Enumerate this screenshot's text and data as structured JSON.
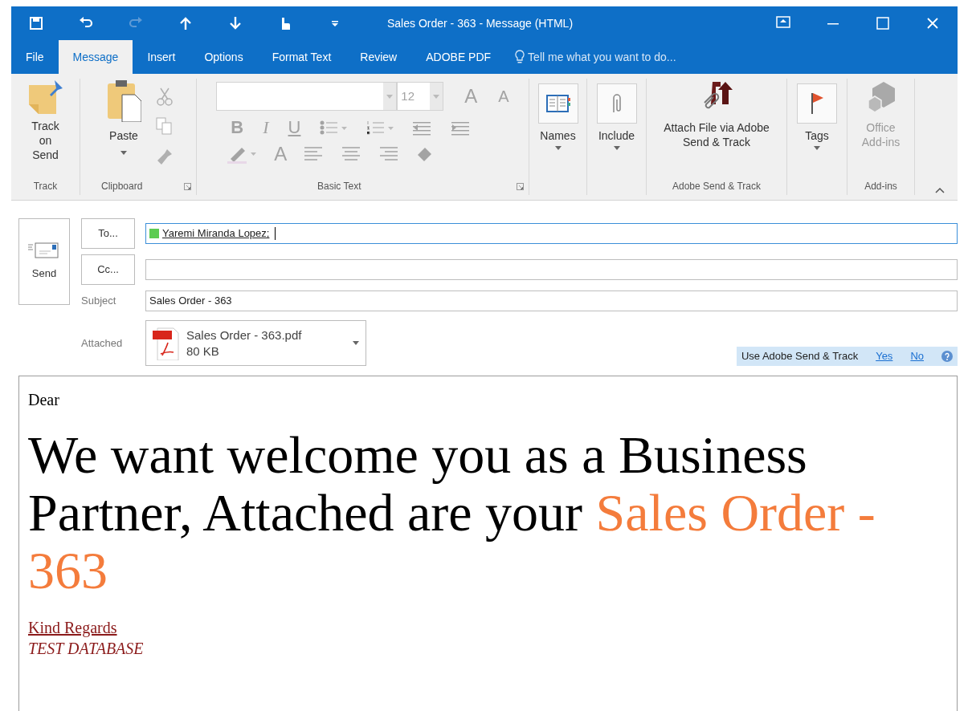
{
  "window": {
    "title": "Sales Order - 363 - Message (HTML)"
  },
  "tabs": [
    {
      "label": "File",
      "selected": false
    },
    {
      "label": "Message",
      "selected": true
    },
    {
      "label": "Insert",
      "selected": false
    },
    {
      "label": "Options",
      "selected": false
    },
    {
      "label": "Format Text",
      "selected": false
    },
    {
      "label": "Review",
      "selected": false
    },
    {
      "label": "ADOBE PDF",
      "selected": false
    }
  ],
  "tell_me": "Tell me what you want to do...",
  "ribbon": {
    "groups": [
      {
        "kind": "track",
        "label": "Track",
        "button": "Track on Send"
      },
      {
        "kind": "clipboard",
        "label": "Clipboard",
        "button": "Paste",
        "tools_disabled": true
      },
      {
        "kind": "basic_text",
        "label": "Basic Text",
        "disabled": true,
        "font_size": "12",
        "glyphs": {
          "grow": "A",
          "shrink": "A",
          "bold": "B",
          "italic": "I",
          "underline": "U",
          "font_color": "A"
        }
      },
      {
        "kind": "names",
        "button": "Names",
        "dropdown": true
      },
      {
        "kind": "include",
        "button": "Include",
        "dropdown": true
      },
      {
        "kind": "adobe",
        "label": "Adobe Send & Track",
        "button": "Attach File via Adobe Send & Track"
      },
      {
        "kind": "tags",
        "button": "Tags",
        "dropdown": true
      },
      {
        "kind": "addins",
        "label": "Add-ins",
        "button": "Office Add-ins",
        "disabled": true
      }
    ]
  },
  "compose": {
    "send_button": "Send",
    "to_button": "To...",
    "cc_button": "Cc...",
    "to": {
      "focused": true,
      "recipients": [
        {
          "name": "Yaremi Miranda Lopez;",
          "color": "#5ccc52"
        }
      ]
    },
    "subject_label": "Subject",
    "subject": "Sales Order - 363",
    "attached_label": "Attached",
    "attachment": {
      "name": "Sales Order - 363.pdf",
      "size": "80 KB"
    },
    "adobe_bar": {
      "text": "Use Adobe Send & Track",
      "yes": "Yes",
      "no": "No"
    }
  },
  "body": {
    "greeting": "Dear",
    "headline": [
      {
        "text": "We want welcome you as a Business Partner, Attached are your ",
        "color": "#000000"
      },
      {
        "text": "Sales Order - 363",
        "color": "#f47c3c"
      }
    ],
    "signoff": "Kind Regards",
    "signature": "TEST DATABASE"
  }
}
